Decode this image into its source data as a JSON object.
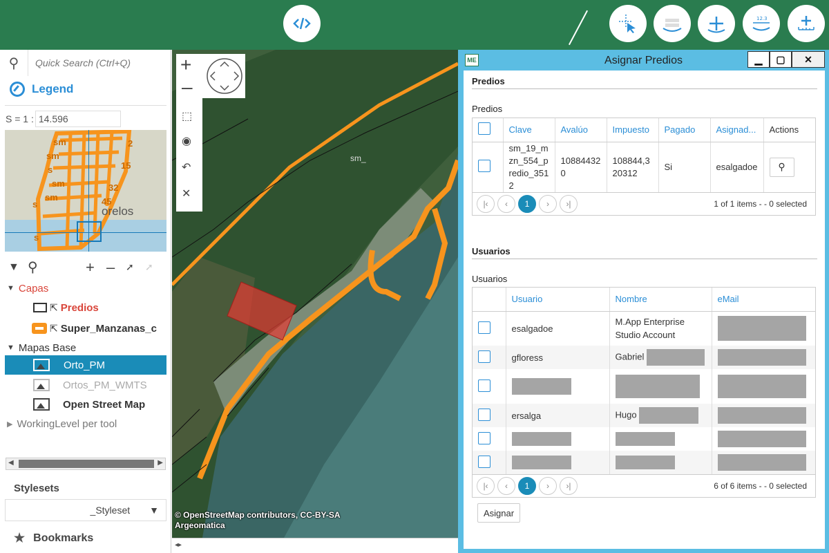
{
  "toolbar": {
    "left_icon": "code-icon",
    "right_icons": [
      "select-pointer-icon",
      "layers-stack-icon",
      "add-point-icon",
      "measure-ruler-icon",
      "add-measure-icon"
    ]
  },
  "left_panel": {
    "search_placeholder": "Quick Search (Ctrl+Q)",
    "legend_label": "Legend",
    "scale_prefix": "S = 1 :",
    "scale_value": "14.596",
    "overview": {
      "labels": [
        "sm",
        "sm",
        "s",
        "sm",
        "sm",
        "s",
        "s",
        "2",
        "15",
        "32",
        "45",
        "ms",
        "nj",
        "15",
        "sm",
        "sm",
        "sm",
        "sm",
        "sm",
        "9",
        "sm"
      ],
      "place_label": "orelos",
      "grid_label": "s"
    },
    "tree": {
      "capas_label": "Capas",
      "predios_label": "Predios",
      "super_manzanas_label": "Super_Manzanas_c",
      "mapas_base_label": "Mapas Base",
      "orto_pm_label": "Orto_PM",
      "ortos_pm_wmts_label": "Ortos_PM_WMTS",
      "open_street_map_label": "Open Street Map",
      "working_level_label": "WorkingLevel per tool"
    },
    "stylesets_label": "Stylesets",
    "styleset_value": "_Styleset",
    "bookmarks_label": "Bookmarks"
  },
  "map": {
    "attribution_line1": "© OpenStreetMap contributors, CC-BY-SA",
    "attribution_line2": "Argeomatica",
    "map_label": "sm_",
    "bottom_text": "◂▸"
  },
  "dialog": {
    "logo_text": "ME",
    "title": "Asignar Predios",
    "minimize": "▁",
    "maximize": "▢",
    "close": "✕",
    "predios_section": "Predios",
    "predios_label": "Predios",
    "predios_columns": [
      "Clave",
      "Avalúo",
      "Impuesto",
      "Pagado",
      "Asignad...",
      "Actions"
    ],
    "predios_rows": [
      {
        "clave": "sm_19_mzn_554_predio_3512",
        "avaluo": "108844320",
        "impuesto": "108844,320312",
        "pagado": "Si",
        "asignado": "esalgadoe"
      }
    ],
    "predios_pager": {
      "page": "1",
      "info": "1 of 1 items - - 0 selected"
    },
    "usuarios_section": "Usuarios",
    "usuarios_label": "Usuarios",
    "usuarios_columns": [
      "Usuario",
      "Nombre",
      "eMail"
    ],
    "usuarios_rows": [
      {
        "usuario": "esalgadoe",
        "nombre": "M.App Enterprise Studio Account"
      },
      {
        "usuario": "gfloress",
        "nombre": "Gabriel"
      },
      {
        "usuario": "",
        "nombre": ""
      },
      {
        "usuario": "ersalga",
        "nombre": "Hugo"
      },
      {
        "usuario": "",
        "nombre": ""
      },
      {
        "usuario": "",
        "nombre": ""
      }
    ],
    "usuarios_pager": {
      "page": "1",
      "info": "6 of 6 items - - 0 selected"
    },
    "asignar_label": "Asignar"
  },
  "colors": {
    "toolbar_green": "#2a7c4f",
    "accent_blue": "#2b8ed6",
    "selected_blue": "#1a8cb8",
    "capas_red": "#d9453a",
    "parcel_orange": "#f7941d",
    "dialog_frame": "#5bbde3"
  }
}
